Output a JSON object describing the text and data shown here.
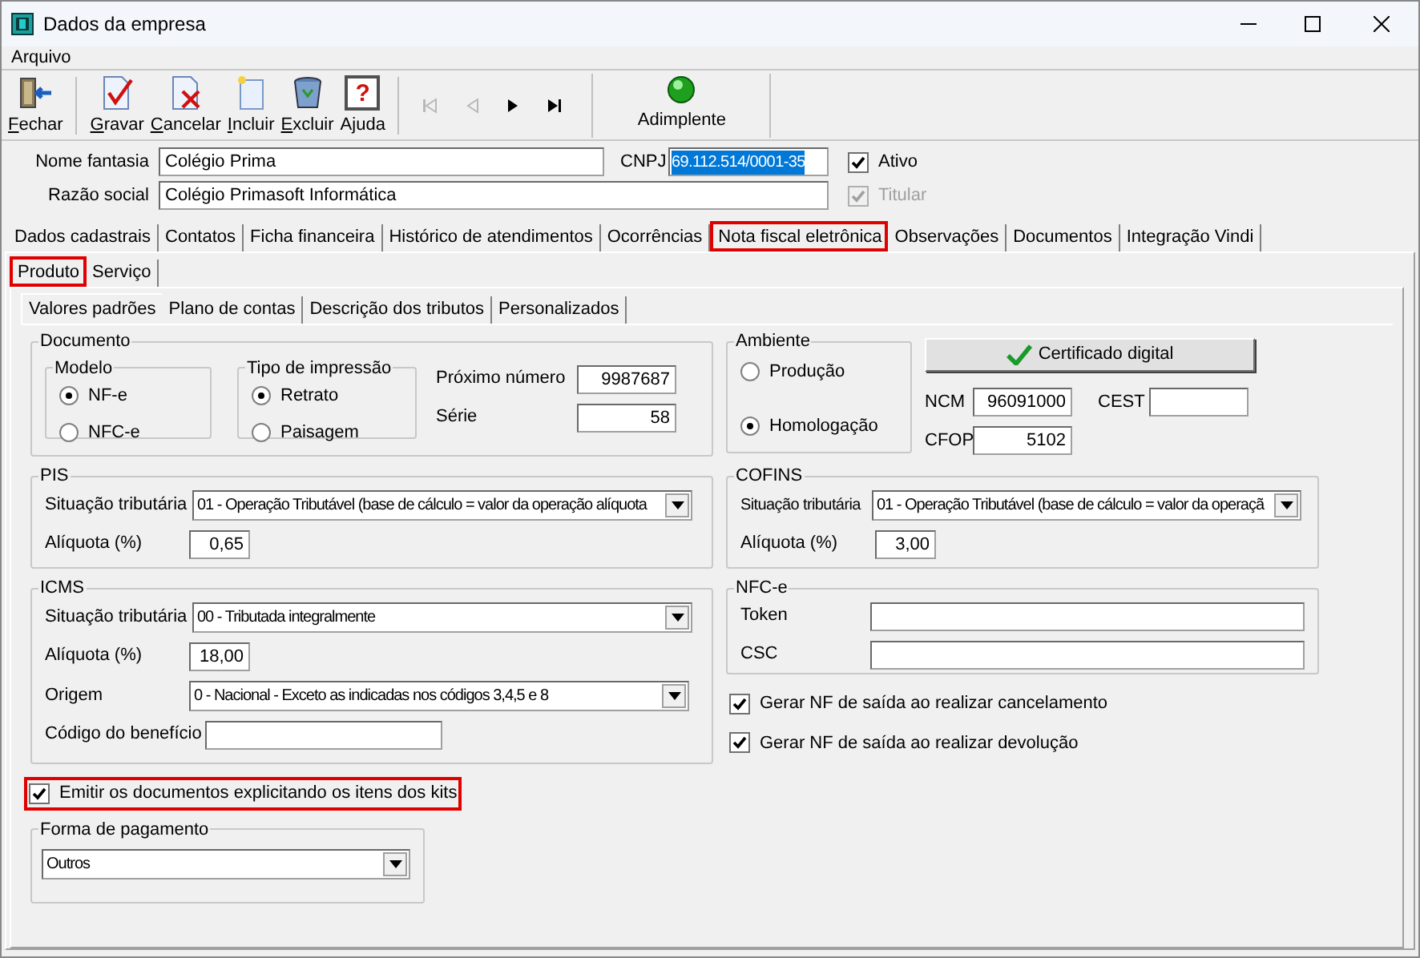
{
  "window": {
    "title": "Dados da empresa"
  },
  "menu": [
    {
      "label": "Arquivo"
    }
  ],
  "toolbar": [
    {
      "label": "Fechar",
      "kind": "close",
      "underline_first": true
    },
    {
      "label": "Gravar",
      "kind": "save",
      "underline_first": true
    },
    {
      "label": "Cancelar",
      "kind": "cancel",
      "underline_first": true
    },
    {
      "label": "Incluir",
      "kind": "new",
      "underline_first": true
    },
    {
      "label": "Excluir",
      "kind": "delete",
      "underline_first": true
    },
    {
      "label": "Ajuda",
      "kind": "help",
      "underline_first": false,
      "glyph": "?"
    }
  ],
  "navigation": [
    {
      "kind": "first",
      "disabled": true
    },
    {
      "kind": "prev",
      "disabled": true
    },
    {
      "kind": "next",
      "disabled": false
    },
    {
      "kind": "last",
      "disabled": false
    }
  ],
  "status": {
    "label": "Adimplente"
  },
  "company": {
    "nome_fantasia": {
      "label": "Nome fantasia",
      "value": "Colégio Prima"
    },
    "cnpj": {
      "label": "CNPJ",
      "value": "69.112.514/0001-35",
      "text_selected": true
    },
    "razao_social": {
      "label": "Razão social",
      "value": "Colégio Primasoft Informática"
    },
    "ativo": {
      "label": "Ativo",
      "checked": true,
      "disabled": false
    },
    "titular": {
      "label": "Titular",
      "checked": true,
      "disabled": true
    }
  },
  "main_tabs": [
    {
      "label": "Dados cadastrais",
      "selected": false,
      "highlighted": false
    },
    {
      "label": "Contatos",
      "selected": false,
      "highlighted": false
    },
    {
      "label": "Ficha financeira",
      "selected": false,
      "highlighted": false
    },
    {
      "label": "Histórico de atendimentos",
      "selected": false,
      "highlighted": false
    },
    {
      "label": "Ocorrências",
      "selected": false,
      "highlighted": false
    },
    {
      "label": "Nota fiscal eletrônica",
      "selected": true,
      "highlighted": true
    },
    {
      "label": "Observações",
      "selected": false,
      "highlighted": false
    },
    {
      "label": "Documentos",
      "selected": false,
      "highlighted": false
    },
    {
      "label": "Integração Vindi",
      "selected": false,
      "highlighted": false
    }
  ],
  "sub_tabs": [
    {
      "label": "Produto",
      "selected": true,
      "highlighted": true
    },
    {
      "label": "Serviço",
      "selected": false,
      "highlighted": false
    }
  ],
  "inner_tabs": [
    {
      "label": "Valores padrões",
      "selected": true,
      "highlighted": false
    },
    {
      "label": "Plano de contas",
      "selected": false,
      "highlighted": false
    },
    {
      "label": "Descrição dos tributos",
      "selected": false,
      "highlighted": false
    },
    {
      "label": "Personalizados",
      "selected": false,
      "highlighted": false
    }
  ],
  "documento": {
    "title": "Documento",
    "modelo": {
      "title": "Modelo",
      "options": [
        {
          "label": "NF-e",
          "selected": true
        },
        {
          "label": "NFC-e",
          "selected": false
        }
      ]
    },
    "tipo_impressao": {
      "title": "Tipo de impressão",
      "options": [
        {
          "label": "Retrato",
          "selected": true
        },
        {
          "label": "Paisagem",
          "selected": false
        }
      ]
    },
    "proximo_numero": {
      "label": "Próximo número",
      "value": "9987687"
    },
    "serie": {
      "label": "Série",
      "value": "58"
    }
  },
  "ambiente": {
    "title": "Ambiente",
    "options": [
      {
        "label": "Produção",
        "selected": false
      },
      {
        "label": "Homologação",
        "selected": true
      }
    ]
  },
  "certificado_button": {
    "label": "Certificado digital"
  },
  "ncm": {
    "label": "NCM",
    "value": "96091000"
  },
  "cest": {
    "label": "CEST"
  },
  "cfop": {
    "label": "CFOP",
    "value": "5102"
  },
  "pis": {
    "title": "PIS",
    "situacao": {
      "label": "Situação tributária",
      "value": "01 - Operação Tributável (base de cálculo = valor da operação alíquota"
    },
    "aliquota": {
      "label": "Alíquota (%)",
      "value": "0,65"
    }
  },
  "cofins": {
    "title": "COFINS",
    "situacao": {
      "label": "Situação tributária",
      "value": "01 - Operação Tributável (base de cálculo = valor da operaçã"
    },
    "aliquota": {
      "label": "Alíquota (%)",
      "value": "3,00"
    }
  },
  "icms": {
    "title": "ICMS",
    "situacao": {
      "label": "Situação tributária",
      "value": "00 - Tributada integralmente"
    },
    "aliquota": {
      "label": "Alíquota (%)",
      "value": "18,00"
    },
    "origem": {
      "label": "Origem",
      "value": "0 - Nacional - Exceto as indicadas nos códigos 3,4,5 e 8"
    },
    "codigo_beneficio": {
      "label": "Código do benefício"
    }
  },
  "nfce": {
    "title": "NFC-e",
    "token": {
      "label": "Token"
    },
    "csc": {
      "label": "CSC"
    }
  },
  "options": [
    {
      "label": "Gerar NF de saída ao realizar cancelamento",
      "checked": true
    },
    {
      "label": "Gerar NF de saída ao realizar devolução",
      "checked": true
    }
  ],
  "emitir_kits": {
    "label": "Emitir os documentos explicitando os itens dos kits",
    "checked": true,
    "highlighted": true
  },
  "forma_pagamento": {
    "title": "Forma de pagamento",
    "value": "Outros"
  }
}
